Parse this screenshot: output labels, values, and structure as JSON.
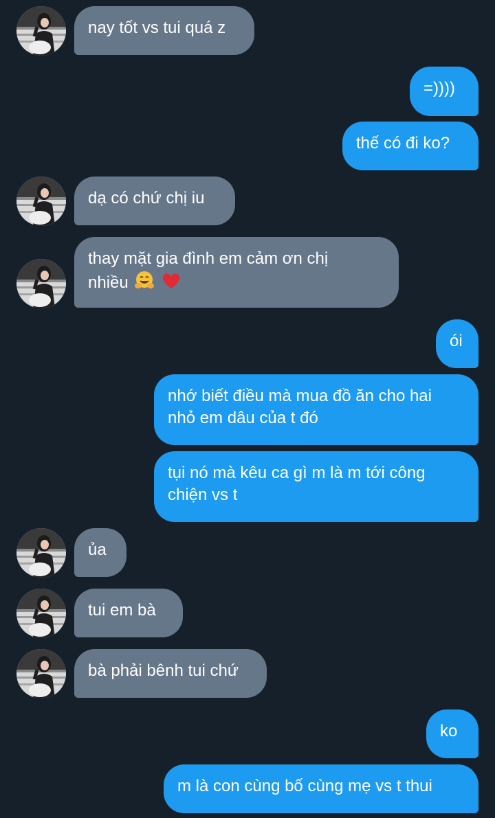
{
  "conversation": {
    "messages": [
      {
        "from": "them",
        "text": "nay tốt vs tui quá z"
      },
      {
        "from": "me",
        "text": "=))))"
      },
      {
        "from": "me",
        "text": "thế có đi ko?"
      },
      {
        "from": "them",
        "text": "dạ có chứ chị iu"
      },
      {
        "from": "them",
        "line1": "thay mặt gia đình em cảm ơn chị",
        "line2": "nhiều",
        "emojis": [
          "hugging-face",
          "red-heart"
        ]
      },
      {
        "from": "me",
        "text": "ói"
      },
      {
        "from": "me",
        "line1": "nhớ biết điều mà mua đồ ăn cho hai",
        "line2": "nhỏ em dâu của t đó"
      },
      {
        "from": "me",
        "line1": "tụi nó mà kêu ca gì m là m tới công",
        "line2": "chiện vs t"
      },
      {
        "from": "them",
        "text": "ủa"
      },
      {
        "from": "them",
        "text": "tui em bà"
      },
      {
        "from": "them",
        "text": "bà phải bênh tui chứ"
      },
      {
        "from": "me",
        "text": "ko"
      },
      {
        "from": "me",
        "text": "m là con cùng bố cùng mẹ vs t thui"
      }
    ]
  },
  "colors": {
    "background": "#16202b",
    "incoming_bubble": "#67778a",
    "outgoing_bubble": "#1d9bf0",
    "text": "#ffffff"
  }
}
